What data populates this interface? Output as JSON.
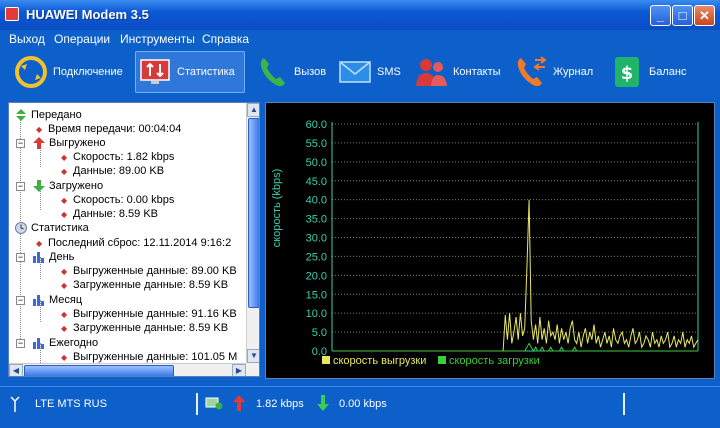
{
  "window": {
    "title": "HUAWEI Modem 3.5"
  },
  "menu": [
    "Выход",
    "Операции",
    "Инструменты",
    "Справка"
  ],
  "toolbar": [
    {
      "label": "Подключение",
      "icon": "connect-icon"
    },
    {
      "label": "Статистика",
      "icon": "statistics-icon",
      "active": true
    },
    {
      "label": "Вызов",
      "icon": "phone-icon"
    },
    {
      "label": "SMS",
      "icon": "envelope-icon"
    },
    {
      "label": "Контакты",
      "icon": "contacts-icon"
    },
    {
      "label": "Журнал",
      "icon": "call-log-icon"
    },
    {
      "label": "Баланс",
      "icon": "balance-icon"
    }
  ],
  "tree": {
    "sent": "Передано",
    "time": "Время передачи: 00:04:04",
    "uploaded": "Выгружено",
    "up_speed": "Скорость: 1.82 kbps",
    "up_data": "Данные: 89.00 KB",
    "downloaded": "Загружено",
    "down_speed": "Скорость: 0.00 kbps",
    "down_data": "Данные: 8.59 KB",
    "stats": "Статистика",
    "last_reset": "Последний сброс: 12.11.2014 9:16:2",
    "day": "День",
    "day_up": "Выгруженные данные: 89.00 KB",
    "day_down": "Загруженные данные: 8.59 KB",
    "month": "Месяц",
    "month_up": "Выгруженные данные: 91.16 KB",
    "month_down": "Загруженные данные: 8.59 KB",
    "yearly": "Ежегодно",
    "year_up": "Выгруженные данные: 101.05 M"
  },
  "colors": {
    "upload": "#e8e860",
    "download": "#3ccc3c",
    "axis": "#38d0b0",
    "grid": "#808040"
  },
  "chart_data": {
    "type": "line",
    "ylabel": "скорость (kbps)",
    "ylim": [
      0,
      60
    ],
    "yticks": [
      "60.0",
      "55.0",
      "50.0",
      "45.0",
      "40.0",
      "35.0",
      "30.0",
      "25.0",
      "20.0",
      "15.0",
      "10.0",
      "5.0",
      "0.0"
    ],
    "series": [
      {
        "name": "скорость выгрузки",
        "values": [
          0,
          0,
          0,
          0,
          0,
          0,
          0,
          0,
          0,
          0,
          0,
          0,
          0,
          0,
          0,
          0,
          0,
          0,
          0,
          0,
          0,
          0,
          0,
          0,
          0,
          0,
          0,
          0,
          0,
          0,
          0,
          0,
          0,
          0,
          0,
          0,
          0,
          0,
          0,
          0,
          0,
          0,
          0,
          0,
          0,
          0,
          0,
          0,
          0,
          0,
          0,
          0,
          0,
          0,
          0,
          0,
          0,
          0,
          0,
          0,
          0,
          0,
          0,
          0,
          0,
          0,
          0,
          0,
          0,
          0,
          0,
          0,
          0,
          0,
          0,
          0,
          0,
          0,
          0,
          0,
          9.5,
          3,
          10,
          2,
          5,
          9,
          3,
          10,
          4,
          6,
          22,
          40,
          8,
          3,
          7,
          2,
          9,
          3,
          6,
          2,
          8,
          4,
          5,
          3,
          7,
          2,
          6,
          3,
          5,
          2,
          6,
          8,
          3,
          2,
          5,
          1,
          4,
          6,
          2,
          5,
          3,
          7,
          2,
          4,
          1,
          3,
          5,
          2,
          4,
          1,
          6,
          3,
          2,
          4,
          5,
          2,
          3,
          1,
          4,
          6,
          2,
          3,
          5,
          1,
          2,
          4,
          3,
          1,
          5,
          2,
          3,
          1,
          4,
          2,
          3,
          5,
          1,
          2,
          4,
          1,
          3,
          2,
          5,
          1,
          3,
          2,
          4,
          1,
          2,
          3
        ]
      },
      {
        "name": "скорость загрузки",
        "values": [
          0,
          0,
          0,
          0,
          0,
          0,
          0,
          0,
          0,
          0,
          0,
          0,
          0,
          0,
          0,
          0,
          0,
          0,
          0,
          0,
          0,
          0,
          0,
          0,
          0,
          0,
          0,
          0,
          0,
          0,
          0,
          0,
          0,
          0,
          0,
          0,
          0,
          0,
          0,
          0,
          0,
          0,
          0,
          0,
          0,
          0,
          0,
          0,
          0,
          0,
          0,
          0,
          0,
          0,
          0,
          0,
          0,
          0,
          0,
          0,
          0,
          0,
          0,
          0,
          0,
          0,
          0,
          0,
          0,
          0,
          0,
          0,
          0,
          0,
          0,
          0,
          0,
          0,
          0,
          0,
          0,
          0,
          0,
          0,
          0,
          0,
          0,
          0,
          0,
          0,
          1,
          2,
          1,
          0,
          1,
          0,
          0,
          1,
          0,
          0,
          0,
          1,
          0,
          0,
          0,
          0,
          1,
          0,
          0,
          0,
          0,
          0,
          1,
          0,
          0,
          0,
          0,
          0,
          0,
          0,
          0,
          0,
          0,
          0,
          0,
          0,
          0,
          0,
          0,
          0,
          0,
          0,
          0,
          0,
          0,
          0,
          0,
          0,
          0,
          0,
          0,
          0,
          0,
          0,
          0,
          0,
          0,
          0,
          0,
          0,
          0,
          0,
          0,
          0,
          0,
          0,
          0,
          0,
          0,
          0,
          0,
          0,
          0,
          0,
          0,
          0,
          0,
          0,
          0,
          0
        ]
      }
    ],
    "grid": true,
    "legend": "bottom"
  },
  "status": {
    "network": "LTE  MTS RUS",
    "upload": "1.82 kbps",
    "download": "0.00 kbps"
  }
}
